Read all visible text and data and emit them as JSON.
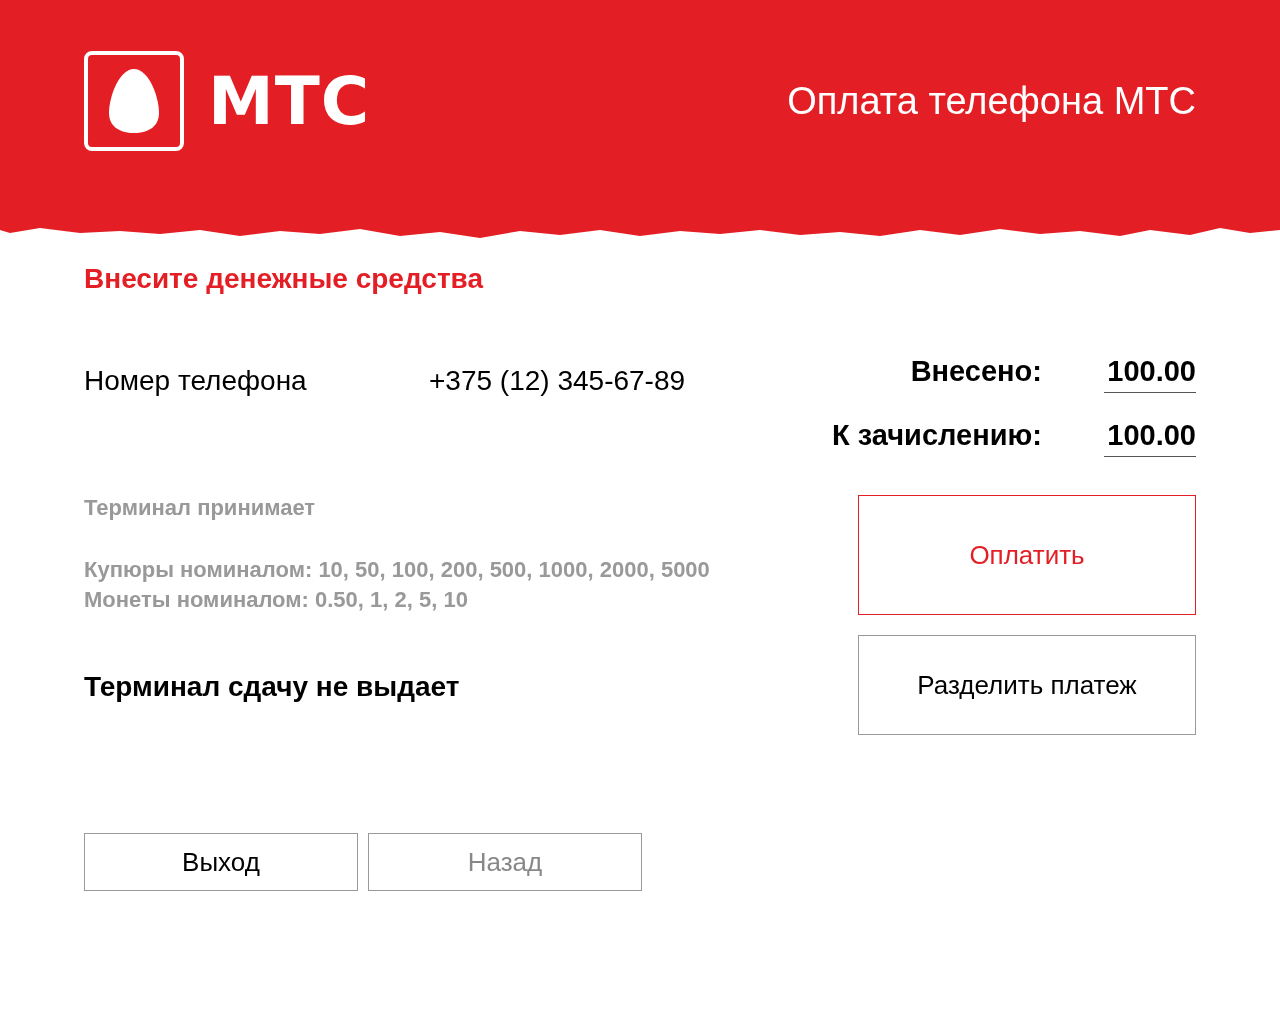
{
  "header": {
    "logo_text": "МТС",
    "title": "Оплата телефона МТС"
  },
  "heading": "Внесите денежные средства",
  "phone": {
    "label": "Номер телефона",
    "value": "+375 (12) 345-67-89"
  },
  "amounts": [
    {
      "label": "Внесено:",
      "value": "100.00"
    },
    {
      "label": "К зачислению:",
      "value": "100.00"
    }
  ],
  "info": {
    "title": "Терминал принимает",
    "lines": [
      "Купюры номиналом: 10, 50, 100, 200, 500, 1000, 2000, 5000",
      "Монеты номиналом: 0.50, 1, 2, 5, 10"
    ]
  },
  "notice": "Терминал сдачу не выдает",
  "actions": [
    {
      "label": "Оплатить",
      "kind": "primary"
    },
    {
      "label": "Разделить платеж",
      "kind": "secondary"
    }
  ],
  "nav_buttons": [
    {
      "label": "Выход",
      "disabled": false
    },
    {
      "label": "Назад",
      "disabled": true
    }
  ]
}
